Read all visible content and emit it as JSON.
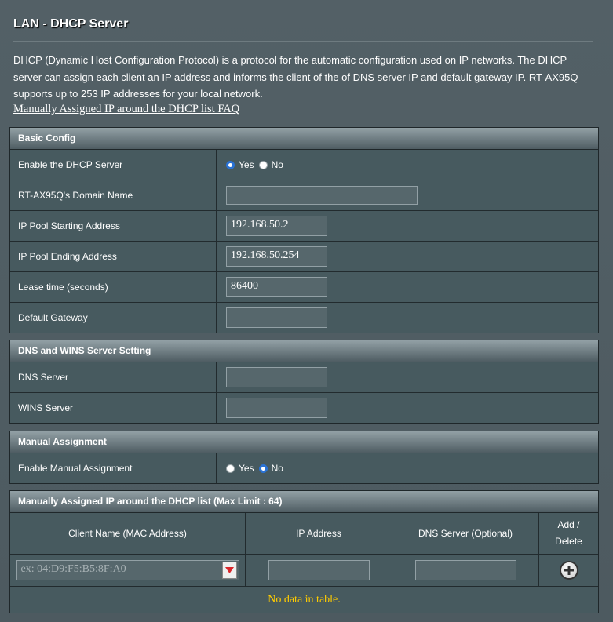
{
  "page": {
    "title": "LAN - DHCP Server",
    "description": "DHCP (Dynamic Host Configuration Protocol) is a protocol for the automatic configuration used on IP networks. The DHCP server can assign each client an IP address and informs the client of the of DNS server IP and default gateway IP. RT-AX95Q supports up to 253 IP addresses for your local network.",
    "faq_link": "Manually Assigned IP around the DHCP list FAQ"
  },
  "basic": {
    "header": "Basic Config",
    "enable_label": "Enable the DHCP Server",
    "yes": "Yes",
    "no": "No",
    "enable_value": "Yes",
    "domain_label": "RT-AX95Q's Domain Name",
    "domain_value": "",
    "start_label": "IP Pool Starting Address",
    "start_value": "192.168.50.2",
    "end_label": "IP Pool Ending Address",
    "end_value": "192.168.50.254",
    "lease_label": "Lease time (seconds)",
    "lease_value": "86400",
    "gateway_label": "Default Gateway",
    "gateway_value": ""
  },
  "dns": {
    "header": "DNS and WINS Server Setting",
    "dns_label": "DNS Server",
    "dns_value": "",
    "wins_label": "WINS Server",
    "wins_value": ""
  },
  "manual": {
    "header": "Manual Assignment",
    "enable_label": "Enable Manual Assignment",
    "yes": "Yes",
    "no": "No",
    "enable_value": "No"
  },
  "list": {
    "header": "Manually Assigned IP around the DHCP list (Max Limit : 64)",
    "col_client": "Client Name (MAC Address)",
    "col_ip": "IP Address",
    "col_dns": "DNS Server (Optional)",
    "col_add_line1": "Add /",
    "col_add_line2": "Delete",
    "mac_placeholder": "ex: 04:D9:F5:B5:8F:A0",
    "no_data": "No data in table."
  },
  "icons": {
    "dropdown": "chevron-down-icon",
    "add": "plus-circle-icon"
  },
  "colors": {
    "background": "#4d5a60",
    "row": "#475a5f",
    "header_gradient_top": "#92a0a5",
    "no_data_text": "#ffcc00",
    "radio_checked": "#2a72d4"
  }
}
